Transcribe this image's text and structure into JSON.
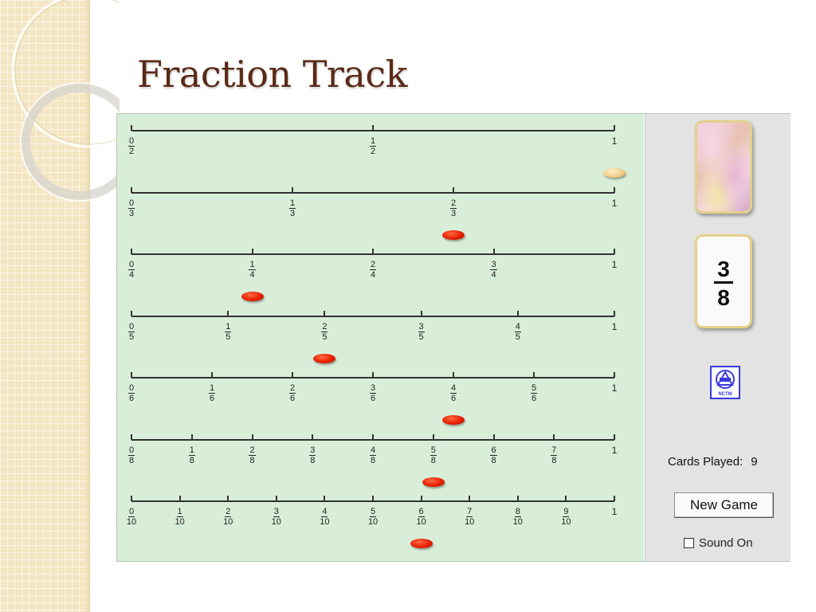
{
  "slide": {
    "title": "Fraction Track"
  },
  "tracks": [
    {
      "denominator": "2",
      "denominators": 2,
      "numerators": [
        "0",
        "1"
      ],
      "whole_label": "1",
      "marker_value": 1.0,
      "marker_style": "gold"
    },
    {
      "denominator": "3",
      "denominators": 3,
      "numerators": [
        "0",
        "1",
        "2"
      ],
      "whole_label": "1",
      "marker_value": 0.6667,
      "marker_style": "red"
    },
    {
      "denominator": "4",
      "denominators": 4,
      "numerators": [
        "0",
        "1",
        "2",
        "3"
      ],
      "whole_label": "1",
      "marker_value": 0.25,
      "marker_style": "red"
    },
    {
      "denominator": "5",
      "denominators": 5,
      "numerators": [
        "0",
        "1",
        "2",
        "3",
        "4"
      ],
      "whole_label": "1",
      "marker_value": 0.4,
      "marker_style": "red"
    },
    {
      "denominator": "6",
      "denominators": 6,
      "numerators": [
        "0",
        "1",
        "2",
        "3",
        "4",
        "5"
      ],
      "whole_label": "1",
      "marker_value": 0.6667,
      "marker_style": "red"
    },
    {
      "denominator": "8",
      "denominators": 8,
      "numerators": [
        "0",
        "1",
        "2",
        "3",
        "4",
        "5",
        "6",
        "7"
      ],
      "whole_label": "1",
      "marker_value": 0.625,
      "marker_style": "red"
    },
    {
      "denominator": "10",
      "denominators": 10,
      "numerators": [
        "0",
        "1",
        "2",
        "3",
        "4",
        "5",
        "6",
        "7",
        "8",
        "9"
      ],
      "whole_label": "1",
      "marker_value": 0.6,
      "marker_style": "red"
    }
  ],
  "current_card": {
    "numerator": "3",
    "denominator": "8"
  },
  "deck_icon": "card-back-icon",
  "logo_icon": "nctm-logo-icon",
  "logo_text": "NCTM",
  "status": {
    "cards_played_label": "Cards Played:",
    "cards_played_count": "9"
  },
  "controls": {
    "new_game_label": "New Game",
    "sound_label": "Sound On",
    "sound_checked": false
  },
  "colors": {
    "title": "#5a2a16",
    "board_bg": "#d9eed8",
    "panel_bg": "#e3e3e3",
    "marker_red": "#e81e00",
    "marker_gold": "#f0cf8a"
  }
}
